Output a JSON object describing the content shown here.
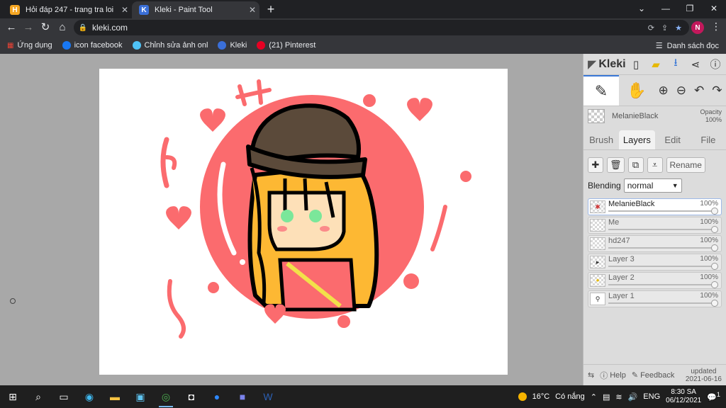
{
  "browser": {
    "tabs": [
      {
        "title": "Hỏi đáp 247 - trang tra loi",
        "favicon_letter": "H",
        "favicon_color": "#f5a623",
        "active": false
      },
      {
        "title": "Kleki - Paint Tool",
        "favicon_letter": "K",
        "favicon_color": "#3a6fd8",
        "active": true
      }
    ],
    "url": "kleki.com",
    "profile_initial": "N",
    "bookmarks": [
      {
        "label": "Ứng dụng",
        "color": "#ea4335"
      },
      {
        "label": "icon facebook",
        "color": "#1877f2"
      },
      {
        "label": "Chỉnh sửa ảnh onl",
        "color": "#4fc3f7"
      },
      {
        "label": "Kleki",
        "color": "#3a6fd8"
      },
      {
        "label": "(21) Pinterest",
        "color": "#e60023"
      }
    ],
    "reading_list": "Danh sách đọc"
  },
  "kleki": {
    "logo": "Kleki",
    "brush_name": "MelanieBlack",
    "opacity_label": "Opacity",
    "opacity_value": "100%",
    "tabs": [
      "Brush",
      "Layers",
      "Edit",
      "File"
    ],
    "active_tab": "Layers",
    "rename_label": "Rename",
    "blending_label": "Blending",
    "blending_value": "normal",
    "layers": [
      {
        "name": "MelanieBlack",
        "opacity": "100%",
        "selected": true
      },
      {
        "name": "Me",
        "opacity": "100%",
        "selected": false
      },
      {
        "name": "hd247",
        "opacity": "100%",
        "selected": false
      },
      {
        "name": "Layer 3",
        "opacity": "100%",
        "selected": false
      },
      {
        "name": "Layer 2",
        "opacity": "100%",
        "selected": false
      },
      {
        "name": "Layer 1",
        "opacity": "100%",
        "selected": false
      }
    ],
    "footer": {
      "help": "Help",
      "feedback": "Feedback",
      "updated_label": "updated",
      "updated_date": "2021-06-16"
    }
  },
  "taskbar": {
    "temperature": "16°C",
    "weather": "Có nắng",
    "language": "ENG",
    "time": "8:30 SA",
    "date": "06/12/2021",
    "notification_count": "1"
  },
  "colors": {
    "accent": "#3a78d6",
    "drawing_red": "#fb6b6e",
    "hair": "#fdb833",
    "hat": "#5b4a3a",
    "skin": "#fde0b8",
    "eyes": "#7be79a"
  }
}
